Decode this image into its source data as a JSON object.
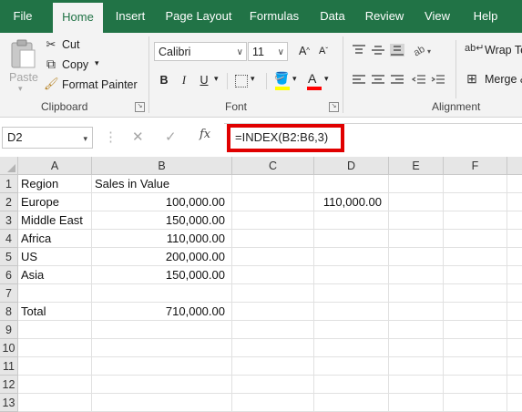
{
  "ribbon_tabs": [
    {
      "label": "File"
    },
    {
      "label": "Home"
    },
    {
      "label": "Insert"
    },
    {
      "label": "Page Layout"
    },
    {
      "label": "Formulas"
    },
    {
      "label": "Data"
    },
    {
      "label": "Review"
    },
    {
      "label": "View"
    },
    {
      "label": "Help"
    }
  ],
  "clipboard": {
    "paste": "Paste",
    "cut": "Cut",
    "copy": "Copy",
    "format_painter": "Format Painter",
    "label": "Clipboard"
  },
  "font": {
    "name": "Calibri",
    "size": "11",
    "grow": "A",
    "shrink": "A",
    "bold": "B",
    "italic": "I",
    "underline": "U",
    "font_color_letter": "A",
    "label": "Font"
  },
  "alignment": {
    "wrap_text": "Wrap Te",
    "merge": "Merge &",
    "label": "Alignment"
  },
  "formula_bar": {
    "name_box": "D2",
    "fx": "fx",
    "formula": "=INDEX(B2:B6,3)"
  },
  "grid": {
    "columns": [
      "A",
      "B",
      "C",
      "D",
      "E",
      "F"
    ],
    "rows": [
      {
        "num": "1",
        "A": "Region",
        "B": "Sales in Value",
        "D": ""
      },
      {
        "num": "2",
        "A": "Europe",
        "B": "100,000.00",
        "D": "110,000.00"
      },
      {
        "num": "3",
        "A": "Middle East",
        "B": "150,000.00",
        "D": ""
      },
      {
        "num": "4",
        "A": "Africa",
        "B": "110,000.00",
        "D": ""
      },
      {
        "num": "5",
        "A": "US",
        "B": "200,000.00",
        "D": ""
      },
      {
        "num": "6",
        "A": "Asia",
        "B": "150,000.00",
        "D": ""
      },
      {
        "num": "7",
        "A": "",
        "B": "",
        "D": ""
      },
      {
        "num": "8",
        "A": "Total",
        "B": "710,000.00",
        "D": ""
      },
      {
        "num": "9",
        "A": "",
        "B": "",
        "D": ""
      },
      {
        "num": "10",
        "A": "",
        "B": "",
        "D": ""
      },
      {
        "num": "11",
        "A": "",
        "B": "",
        "D": ""
      },
      {
        "num": "12",
        "A": "",
        "B": "",
        "D": ""
      },
      {
        "num": "13",
        "A": "",
        "B": "",
        "D": ""
      }
    ]
  },
  "colors": {
    "ribbon_green": "#217346",
    "highlight_red": "#e00000",
    "font_color_bar": "#ff0000",
    "fill_color_bar": "#ffff00"
  }
}
